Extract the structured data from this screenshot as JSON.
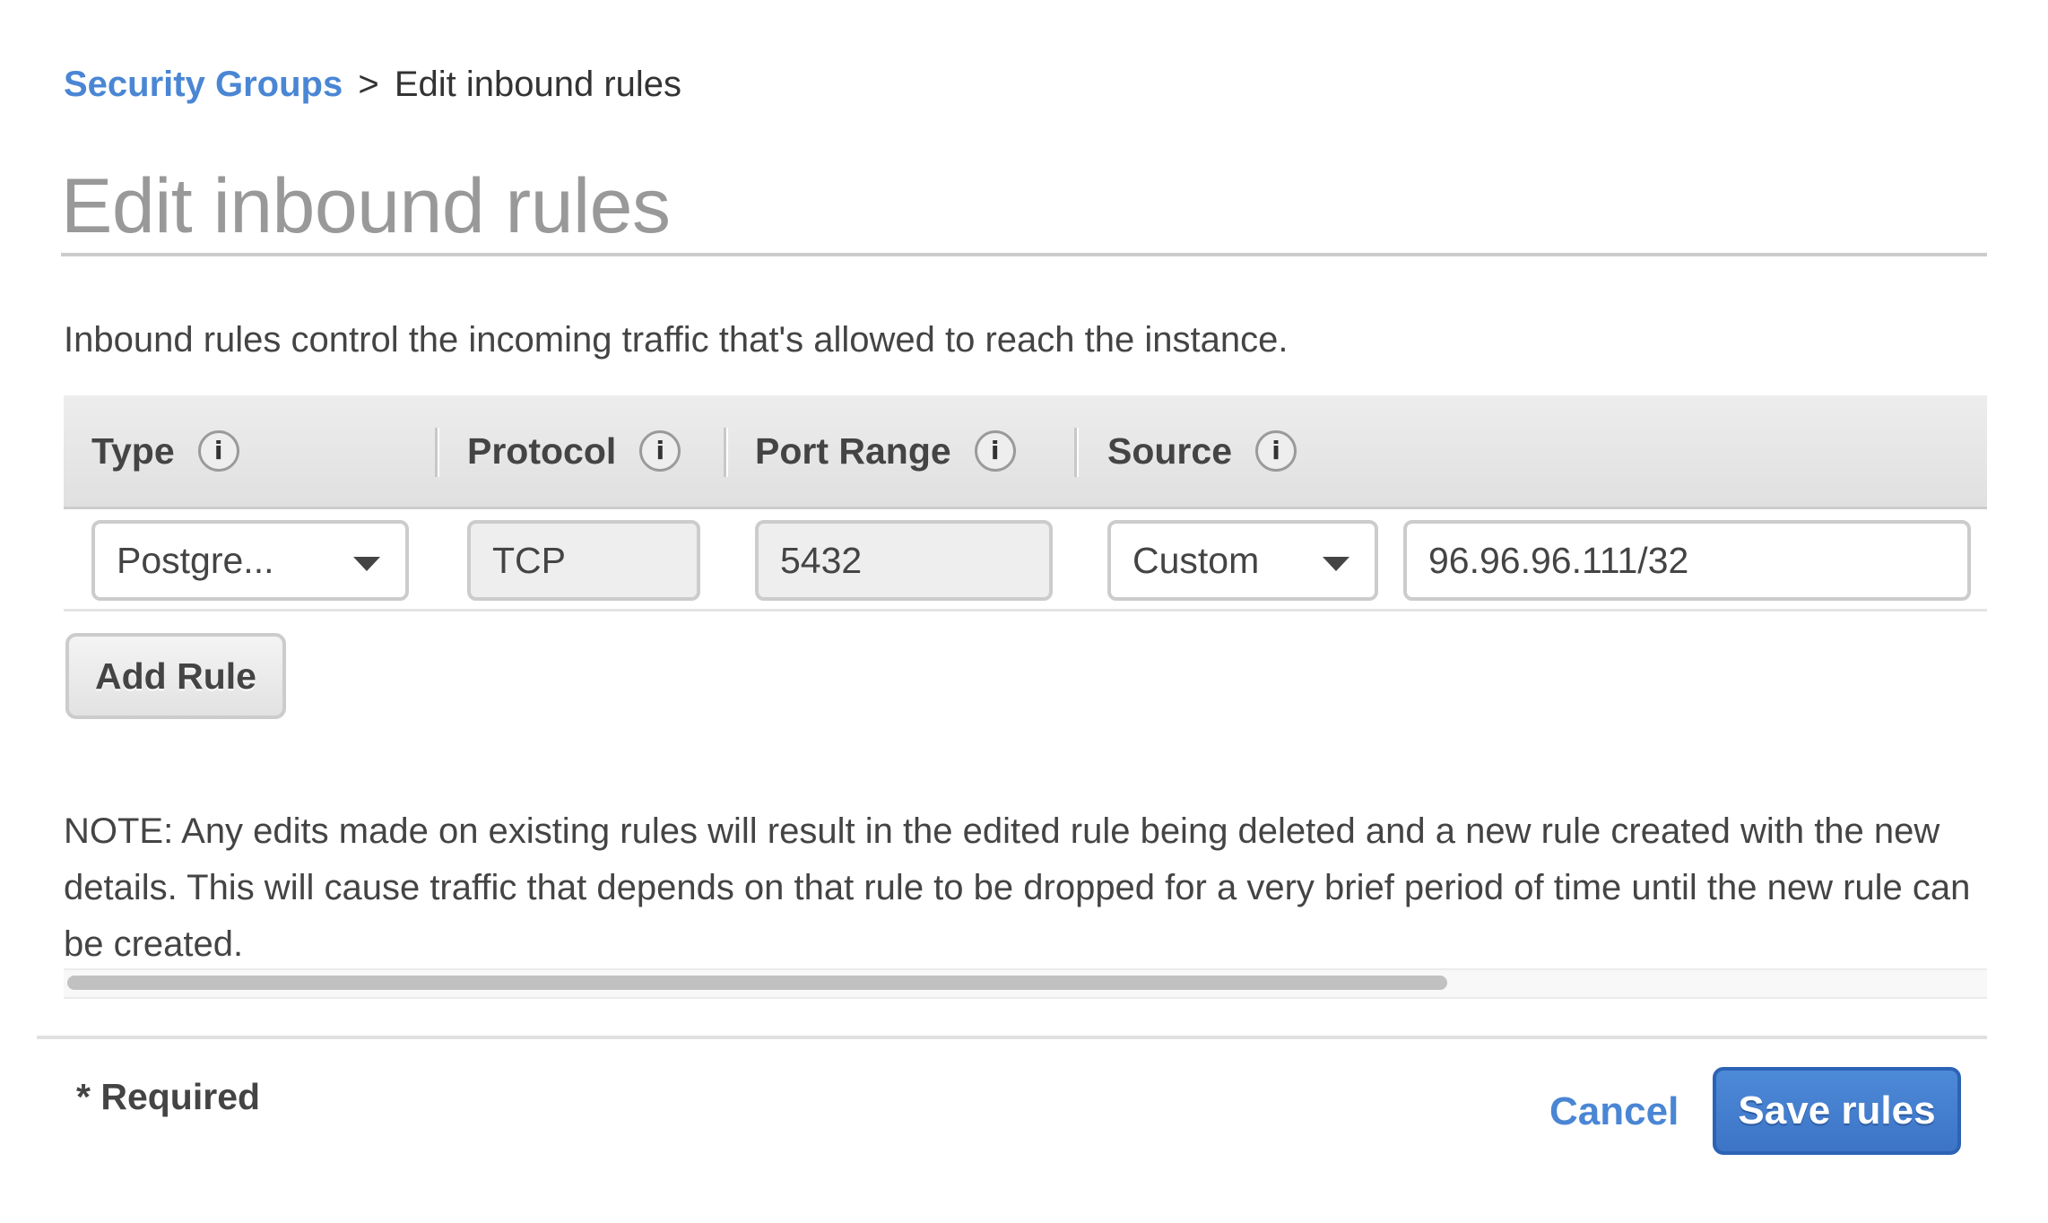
{
  "breadcrumb": {
    "parent": "Security Groups",
    "separator": ">",
    "current": "Edit inbound rules"
  },
  "page_title": "Edit inbound rules",
  "intro_text": "Inbound rules control the incoming traffic that's allowed to reach the instance.",
  "table": {
    "columns": [
      {
        "label": "Type",
        "icon": "info-icon"
      },
      {
        "label": "Protocol",
        "icon": "info-icon"
      },
      {
        "label": "Port Range",
        "icon": "info-icon"
      },
      {
        "label": "Source",
        "icon": "info-icon"
      }
    ],
    "rows": [
      {
        "type": "Postgre...",
        "protocol": "TCP",
        "port_range": "5432",
        "source_type": "Custom",
        "source_value": "96.96.96.111/32"
      }
    ]
  },
  "add_rule_label": "Add Rule",
  "note_text": "NOTE: Any edits made on existing rules will result in the edited rule being deleted and a new rule created with the new details. This will cause traffic that depends on that rule to be dropped for a very brief period of time until the new rule can be created.",
  "scrollbar": {
    "thumb_fraction": 0.72
  },
  "footer": {
    "required_label": "* Required",
    "cancel_label": "Cancel",
    "save_label": "Save rules"
  },
  "colors": {
    "link": "#4a86d4",
    "primary_button": "#4580d0",
    "title_gray": "#999999"
  }
}
